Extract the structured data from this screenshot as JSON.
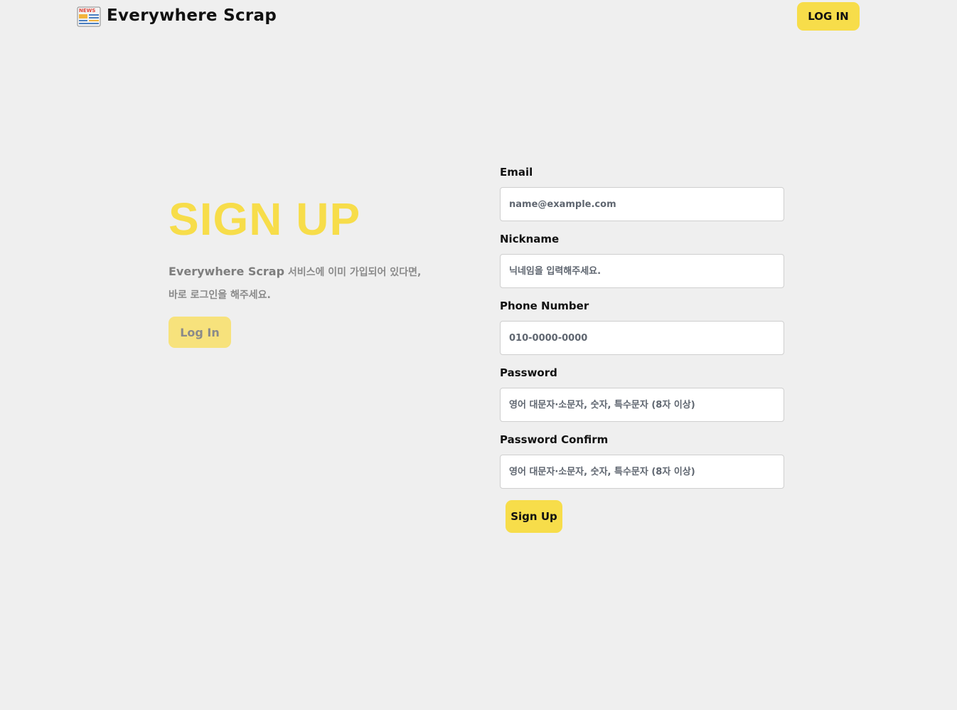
{
  "navbar": {
    "brand_text": "Everywhere Scrap",
    "brand_icon": "newspaper-icon",
    "login_label": "LOG IN"
  },
  "hero": {
    "title": "SIGN UP",
    "desc_brand": "Everywhere Scrap",
    "desc_line1_rest": " 서비스에 이미 가입되어 있다면,",
    "desc_line2": "바로 로그인을 해주세요.",
    "login_label": "Log In"
  },
  "form": {
    "email": {
      "label": "Email",
      "placeholder": "name@example.com"
    },
    "nickname": {
      "label": "Nickname",
      "placeholder": "닉네임을 입력해주세요."
    },
    "phone": {
      "label": "Phone Number",
      "placeholder": "010-0000-0000"
    },
    "password": {
      "label": "Password",
      "placeholder": "영어 대문자·소문자, 숫자, 특수문자 (8자 이상)"
    },
    "password_confirm": {
      "label": "Password Confirm",
      "placeholder": "영어 대문자·소문자, 숫자, 특수문자 (8자 이상)"
    },
    "submit_label": "Sign Up"
  },
  "colors": {
    "accent": "#f7dd4a",
    "accent_muted": "#f7e27c",
    "background": "#efefef"
  }
}
